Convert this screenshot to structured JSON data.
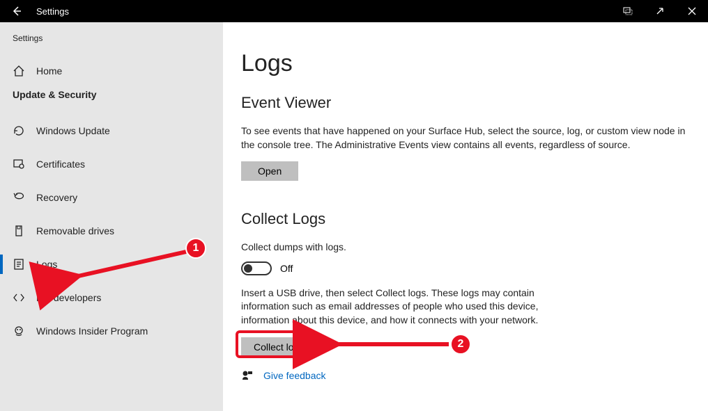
{
  "titlebar": {
    "title": "Settings"
  },
  "sidebar": {
    "app_label": "Settings",
    "home": "Home",
    "section": "Update & Security",
    "items": [
      {
        "label": "Windows Update"
      },
      {
        "label": "Certificates"
      },
      {
        "label": "Recovery"
      },
      {
        "label": "Removable drives"
      },
      {
        "label": "Logs"
      },
      {
        "label": "For developers"
      },
      {
        "label": "Windows Insider Program"
      }
    ]
  },
  "main": {
    "page_title": "Logs",
    "event_viewer": {
      "heading": "Event Viewer",
      "description": "To see events that have happened on your Surface Hub, select the source, log, or custom view node in the console tree. The Administrative Events view contains all events, regardless of source.",
      "open_button": "Open"
    },
    "collect_logs": {
      "heading": "Collect Logs",
      "toggle_caption": "Collect dumps with logs.",
      "toggle_state": "Off",
      "description": "Insert a USB drive, then select Collect logs. These logs may contain information such as email addresses of people who used this device, information about this device, and how it connects with your network.",
      "collect_button": "Collect logs"
    },
    "feedback_link": "Give feedback"
  },
  "annotations": {
    "step1": "1",
    "step2": "2"
  }
}
